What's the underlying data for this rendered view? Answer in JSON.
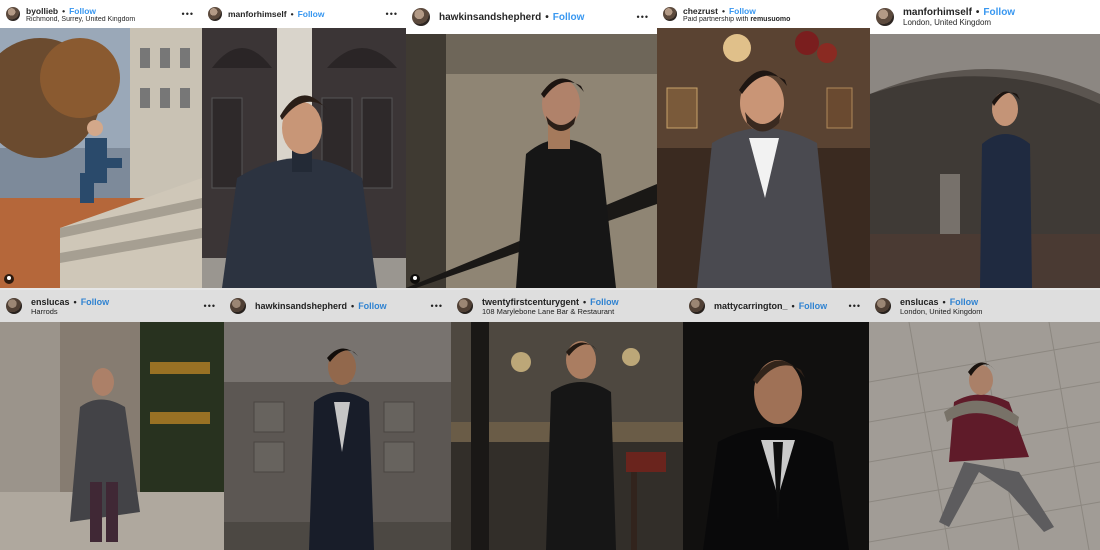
{
  "posts": [
    {
      "username": "byollieb",
      "follow": "Follow",
      "location": "Richmond, Surrey, United Kingdom",
      "more": "•••"
    },
    {
      "username": "manforhimself",
      "follow": "Follow",
      "location": "",
      "more": "•••"
    },
    {
      "username": "hawkinsandshepherd",
      "follow": "Follow",
      "location": "",
      "more": "•••"
    },
    {
      "username": "chezrust",
      "follow": "Follow",
      "location": "Paid partnership with",
      "partner": "remusuomo",
      "more": ""
    },
    {
      "username": "manforhimself",
      "follow": "Follow",
      "location": "London, United Kingdom",
      "more": ""
    },
    {
      "username": "enslucas",
      "follow": "Follow",
      "location": "Harrods",
      "more": "•••"
    },
    {
      "username": "hawkinsandshepherd",
      "follow": "Follow",
      "location": "",
      "more": "•••"
    },
    {
      "username": "twentyfirstcenturygent",
      "follow": "Follow",
      "location": "108 Marylebone Lane Bar & Restaurant",
      "more": "•••"
    },
    {
      "username": "mattycarrington_",
      "follow": "Follow",
      "location": "",
      "more": "•••"
    },
    {
      "username": "enslucas",
      "follow": "Follow",
      "location": "London, United Kingdom",
      "more": ""
    }
  ],
  "separator": "•",
  "icons": {
    "more": "more-options-icon",
    "tag": "user-tag-icon"
  }
}
